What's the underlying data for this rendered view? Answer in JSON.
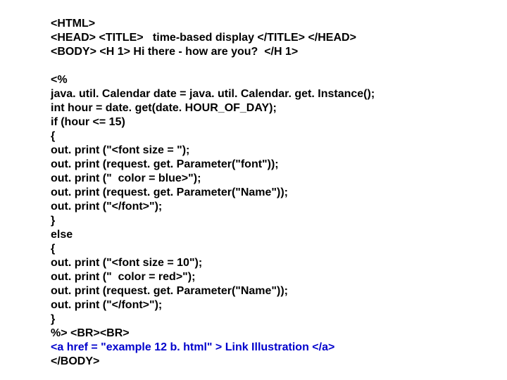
{
  "lines": [
    {
      "text": "<HTML>",
      "blue": false
    },
    {
      "text": "<HEAD> <TITLE>   time-based display </TITLE> </HEAD>",
      "blue": false
    },
    {
      "text": "<BODY> <H 1> Hi there - how are you?  </H 1>",
      "blue": false
    },
    {
      "text": " ",
      "blue": false
    },
    {
      "text": "<%",
      "blue": false
    },
    {
      "text": "java. util. Calendar date = java. util. Calendar. get. Instance();",
      "blue": false
    },
    {
      "text": "int hour = date. get(date. HOUR_OF_DAY);",
      "blue": false
    },
    {
      "text": "if (hour <= 15)",
      "blue": false
    },
    {
      "text": "{",
      "blue": false
    },
    {
      "text": "out. print (\"<font size = \");",
      "blue": false
    },
    {
      "text": "out. print (request. get. Parameter(\"font\"));",
      "blue": false
    },
    {
      "text": "out. print (\"  color = blue>\");",
      "blue": false
    },
    {
      "text": "out. print (request. get. Parameter(\"Name\"));",
      "blue": false
    },
    {
      "text": "out. print (\"</font>\");",
      "blue": false
    },
    {
      "text": "}",
      "blue": false
    },
    {
      "text": "else",
      "blue": false
    },
    {
      "text": "{",
      "blue": false
    },
    {
      "text": "out. print (\"<font size = 10\");",
      "blue": false
    },
    {
      "text": "out. print (\"  color = red>\");",
      "blue": false
    },
    {
      "text": "out. print (request. get. Parameter(\"Name\"));",
      "blue": false
    },
    {
      "text": "out. print (\"</font>\");",
      "blue": false
    },
    {
      "text": "}",
      "blue": false
    },
    {
      "text": "%> <BR><BR>",
      "blue": false
    },
    {
      "text": "<a href = \"example 12 b. html\" > Link Illustration </a>",
      "blue": true
    },
    {
      "text": "</BODY>",
      "blue": false
    }
  ]
}
